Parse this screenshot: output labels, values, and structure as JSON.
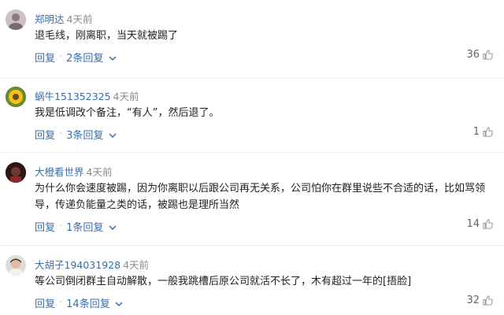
{
  "comments": [
    {
      "username": "郑明达",
      "time": "4天前",
      "text": "退毛线，刚离职，当天就被踢了",
      "reply_label": "回复",
      "replies_label": "2条回复",
      "likes": "36"
    },
    {
      "username": "蜗牛151352325",
      "time": "4天前",
      "text": "我是低调改个备注，“有人”，然后退了。",
      "reply_label": "回复",
      "replies_label": "3条回复",
      "likes": "1"
    },
    {
      "username": "大橙看世界",
      "time": "4天前",
      "text": "为什么你会速度被踢，因为你离职以后跟公司再无关系，公司怕你在群里说些不合适的话，比如骂领导，传递负能量之类的话，被踢也是理所当然",
      "reply_label": "回复",
      "replies_label": "1条回复",
      "likes": "14"
    },
    {
      "username": "大胡子194031928",
      "time": "4天前",
      "text": "等公司倒闭群主自动解散，一般我跳槽后原公司就活不长了，木有超过一年的[捂脸]",
      "reply_label": "回复",
      "replies_label": "14条回复",
      "likes": "32"
    }
  ],
  "icons": {
    "like": "thumbs-up-icon",
    "expand": "chevron-down-icon"
  },
  "colors": {
    "link": "#3a6ea8",
    "meta": "#8a8a8a",
    "divider": "#ececec"
  }
}
